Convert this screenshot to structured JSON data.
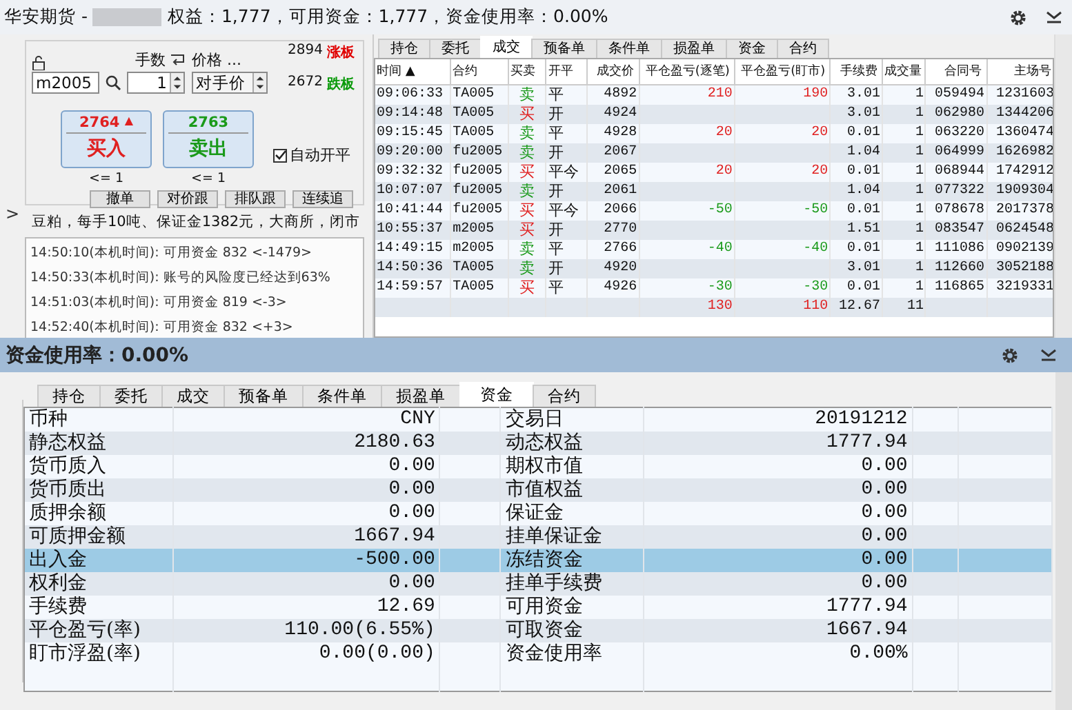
{
  "window": {
    "title": "华安期货 -",
    "account_stats": "权益：1,777，可用资金：1,777，资金使用率：0.00%"
  },
  "order_panel": {
    "lot_label": "手数",
    "price_label": "价格 ...",
    "symbol": "m2005",
    "lots": "1",
    "price_type": "对手价",
    "limit_up": {
      "price": "2894",
      "label": "涨板"
    },
    "limit_down": {
      "price": "2672",
      "label": "跌板"
    },
    "buy": {
      "price": "2764",
      "arrow": "▲",
      "label": "买入",
      "max": "<= 1"
    },
    "sell": {
      "price": "2763",
      "label": "卖出",
      "max": "<= 1"
    },
    "auto_open_close": {
      "label": "自动开平",
      "checked": true
    },
    "actions": [
      "撤单",
      "对价跟",
      "排队跟",
      "连续追"
    ],
    "info": "豆粕，每手10吨、保证金1382元，大商所，闭市",
    "expand_arrow": ">",
    "log": [
      "14:50:10(本机时间): 可用资金 832  <-1479>",
      "14:50:33(本机时间): 账号的风险度已经达到63%",
      "14:51:03(本机时间): 可用资金 819  <-3>",
      "14:52:40(本机时间): 可用资金 832  <+3>"
    ]
  },
  "trades": {
    "tabs": [
      {
        "label": "持仓",
        "selected": false
      },
      {
        "label": "委托",
        "selected": false
      },
      {
        "label": "成交",
        "selected": true
      },
      {
        "label": "预备单",
        "selected": false
      },
      {
        "label": "条件单",
        "selected": false
      },
      {
        "label": "损盈单",
        "selected": false
      },
      {
        "label": "资金",
        "selected": false
      },
      {
        "label": "合约",
        "selected": false
      }
    ],
    "columns": [
      "时间 ▲",
      "合约",
      "买卖",
      "开平",
      "成交价",
      "平仓盈亏(逐笔)",
      "平仓盈亏(盯市)",
      "手续费",
      "成交量",
      "合同号",
      "主场号"
    ],
    "rows": [
      {
        "time": "09:06:33",
        "contract": "TA005",
        "side": {
          "text": "卖",
          "color": "#1a9a1a"
        },
        "offset": "平",
        "price": "4892",
        "pnl_trade": {
          "text": "210",
          "color": "#e02020"
        },
        "pnl_mark": {
          "text": "190",
          "color": "#e02020"
        },
        "fee": "3.01",
        "qty": "1",
        "order_no": "059494",
        "exchange_no": "1231603"
      },
      {
        "time": "09:14:48",
        "contract": "TA005",
        "side": {
          "text": "买",
          "color": "#e02020"
        },
        "offset": "开",
        "price": "4924",
        "fee": "3.01",
        "qty": "1",
        "order_no": "062980",
        "exchange_no": "1344206"
      },
      {
        "time": "09:15:45",
        "contract": "TA005",
        "side": {
          "text": "卖",
          "color": "#1a9a1a"
        },
        "offset": "平",
        "price": "4928",
        "pnl_trade": {
          "text": "20",
          "color": "#e02020"
        },
        "pnl_mark": {
          "text": "20",
          "color": "#e02020"
        },
        "fee": "0.01",
        "qty": "1",
        "order_no": "063220",
        "exchange_no": "1360474"
      },
      {
        "time": "09:20:00",
        "contract": "fu2005",
        "side": {
          "text": "卖",
          "color": "#1a9a1a"
        },
        "offset": "开",
        "price": "2067",
        "fee": "1.04",
        "qty": "1",
        "order_no": "064999",
        "exchange_no": "1626982"
      },
      {
        "time": "09:32:32",
        "contract": "fu2005",
        "side": {
          "text": "买",
          "color": "#e02020"
        },
        "offset": "平今",
        "price": "2065",
        "pnl_trade": {
          "text": "20",
          "color": "#e02020"
        },
        "pnl_mark": {
          "text": "20",
          "color": "#e02020"
        },
        "fee": "0.01",
        "qty": "1",
        "order_no": "068944",
        "exchange_no": "1742912"
      },
      {
        "time": "10:07:07",
        "contract": "fu2005",
        "side": {
          "text": "卖",
          "color": "#1a9a1a"
        },
        "offset": "开",
        "price": "2061",
        "fee": "1.04",
        "qty": "1",
        "order_no": "077322",
        "exchange_no": "1909304"
      },
      {
        "time": "10:41:44",
        "contract": "fu2005",
        "side": {
          "text": "买",
          "color": "#e02020"
        },
        "offset": "平今",
        "price": "2066",
        "pnl_trade": {
          "text": "-50",
          "color": "#1a9a1a"
        },
        "pnl_mark": {
          "text": "-50",
          "color": "#1a9a1a"
        },
        "fee": "0.01",
        "qty": "1",
        "order_no": "078678",
        "exchange_no": "2017378"
      },
      {
        "time": "10:55:37",
        "contract": "m2005",
        "side": {
          "text": "买",
          "color": "#e02020"
        },
        "offset": "开",
        "price": "2770",
        "fee": "1.51",
        "qty": "1",
        "order_no": "083547",
        "exchange_no": "0624548"
      },
      {
        "time": "14:49:15",
        "contract": "m2005",
        "side": {
          "text": "卖",
          "color": "#1a9a1a"
        },
        "offset": "平",
        "price": "2766",
        "pnl_trade": {
          "text": "-40",
          "color": "#1a9a1a"
        },
        "pnl_mark": {
          "text": "-40",
          "color": "#1a9a1a"
        },
        "fee": "0.01",
        "qty": "1",
        "order_no": "111086",
        "exchange_no": "0902139"
      },
      {
        "time": "14:50:36",
        "contract": "TA005",
        "side": {
          "text": "卖",
          "color": "#1a9a1a"
        },
        "offset": "开",
        "price": "4920",
        "fee": "3.01",
        "qty": "1",
        "order_no": "112660",
        "exchange_no": "3052188"
      },
      {
        "time": "14:59:57",
        "contract": "TA005",
        "side": {
          "text": "买",
          "color": "#e02020"
        },
        "offset": "平",
        "price": "4926",
        "pnl_trade": {
          "text": "-30",
          "color": "#1a9a1a"
        },
        "pnl_mark": {
          "text": "-30",
          "color": "#1a9a1a"
        },
        "fee": "0.01",
        "qty": "1",
        "order_no": "116865",
        "exchange_no": "3219331"
      }
    ],
    "totals": {
      "pnl_trade": {
        "text": "130",
        "color": "#e02020"
      },
      "pnl_mark": {
        "text": "110",
        "color": "#e02020"
      },
      "fee": "12.67",
      "qty": "11"
    }
  },
  "funds": {
    "title": "资金使用率：0.00%",
    "tabs": [
      {
        "label": "持仓",
        "selected": false
      },
      {
        "label": "委托",
        "selected": false
      },
      {
        "label": "成交",
        "selected": false
      },
      {
        "label": "预备单",
        "selected": false
      },
      {
        "label": "条件单",
        "selected": false
      },
      {
        "label": "损盈单",
        "selected": false
      },
      {
        "label": "资金",
        "selected": true
      },
      {
        "label": "合约",
        "selected": false
      }
    ],
    "rows": [
      {
        "label": "币种",
        "value": "CNY",
        "label_2": "交易日",
        "value_2": "20191212",
        "selected": false
      },
      {
        "label": "静态权益",
        "value": "2180.63",
        "label_2": "动态权益",
        "value_2": "1777.94",
        "selected": false
      },
      {
        "label": "货币质入",
        "value": "0.00",
        "label_2": "期权市值",
        "value_2": "0.00",
        "selected": false
      },
      {
        "label": "货币质出",
        "value": "0.00",
        "label_2": "市值权益",
        "value_2": "0.00",
        "selected": false
      },
      {
        "label": "质押余额",
        "value": "0.00",
        "label_2": "保证金",
        "value_2": "0.00",
        "selected": false
      },
      {
        "label": "可质押金额",
        "value": "1667.94",
        "label_2": "挂单保证金",
        "value_2": "0.00",
        "selected": false
      },
      {
        "label": "出入金",
        "value": "-500.00",
        "label_2": "冻结资金",
        "value_2": "0.00",
        "selected": true
      },
      {
        "label": "权利金",
        "value": "0.00",
        "label_2": "挂单手续费",
        "value_2": "0.00",
        "selected": false
      },
      {
        "label": "手续费",
        "value": "12.69",
        "label_2": "可用资金",
        "value_2": "1777.94",
        "selected": false
      },
      {
        "label": "平仓盈亏(率)",
        "value": "110.00(6.55%)",
        "label_2": "可取资金",
        "value_2": "1667.94",
        "selected": false
      },
      {
        "label": "盯市浮盈(率)",
        "value": "0.00(0.00)",
        "label_2": "资金使用率",
        "value_2": "0.00%",
        "selected": false
      }
    ]
  }
}
